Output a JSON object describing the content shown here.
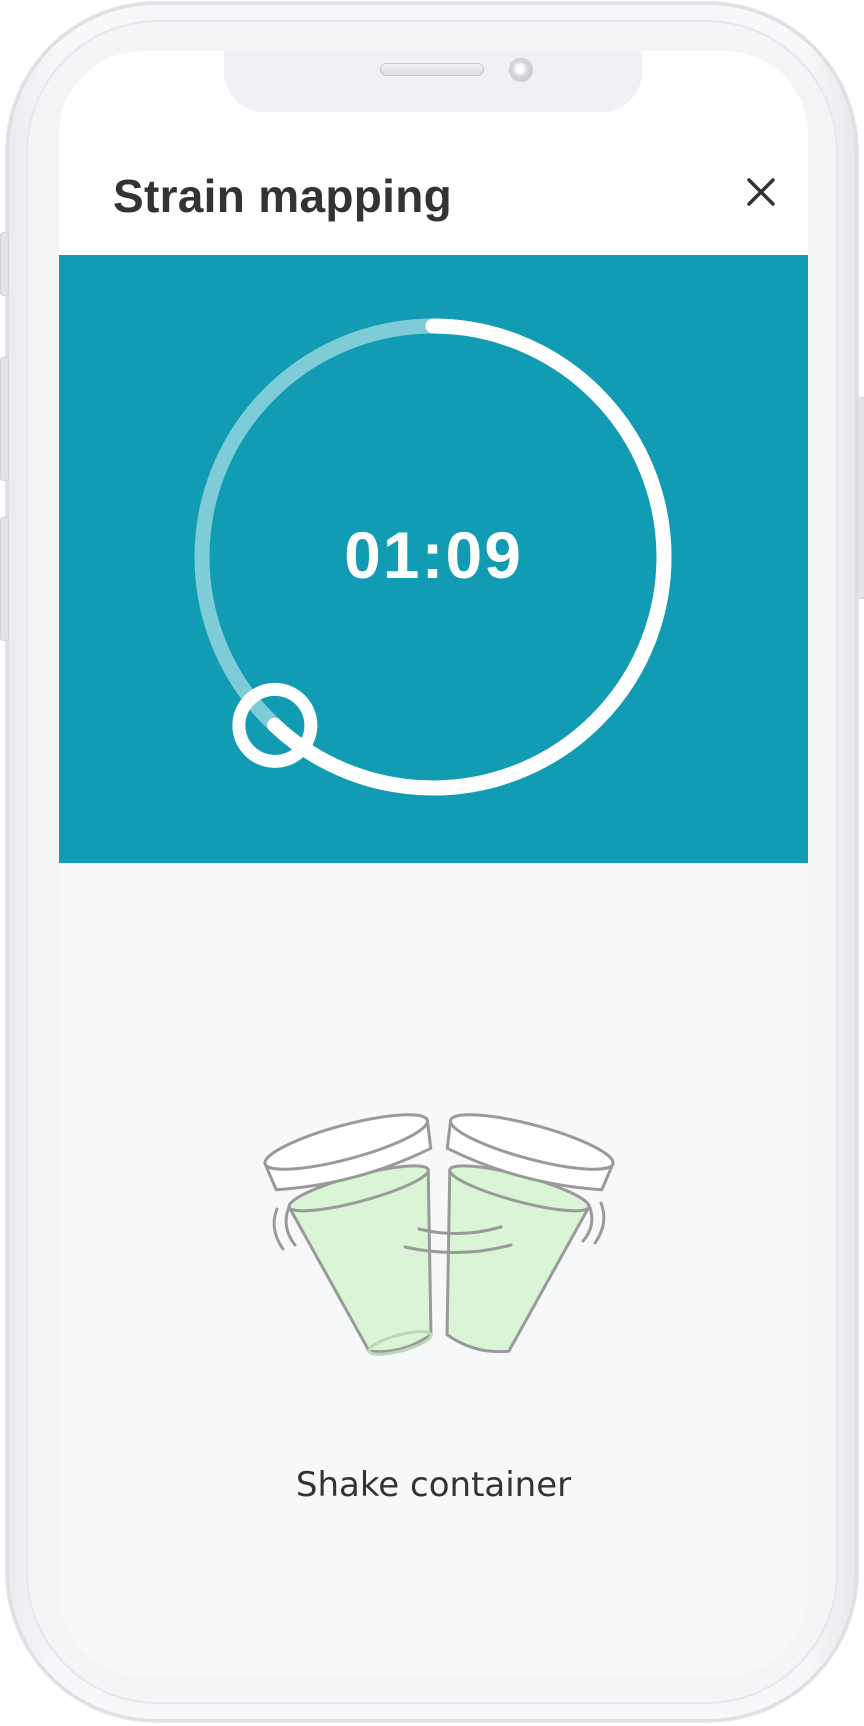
{
  "header": {
    "title": "Strain mapping",
    "close_icon": "close-icon"
  },
  "timer": {
    "display": "01:09",
    "progress_fraction": 0.62,
    "track_color": "#7fccd9",
    "progress_color": "#ffffff",
    "background_color": "#129cb3"
  },
  "instruction": {
    "illustration_icon": "shaking-containers-illustration",
    "caption": "Shake container"
  },
  "colors": {
    "accent": "#129cb3",
    "text": "#333333",
    "liquid": "#d9f5d6",
    "outline": "#9a9a9a"
  }
}
